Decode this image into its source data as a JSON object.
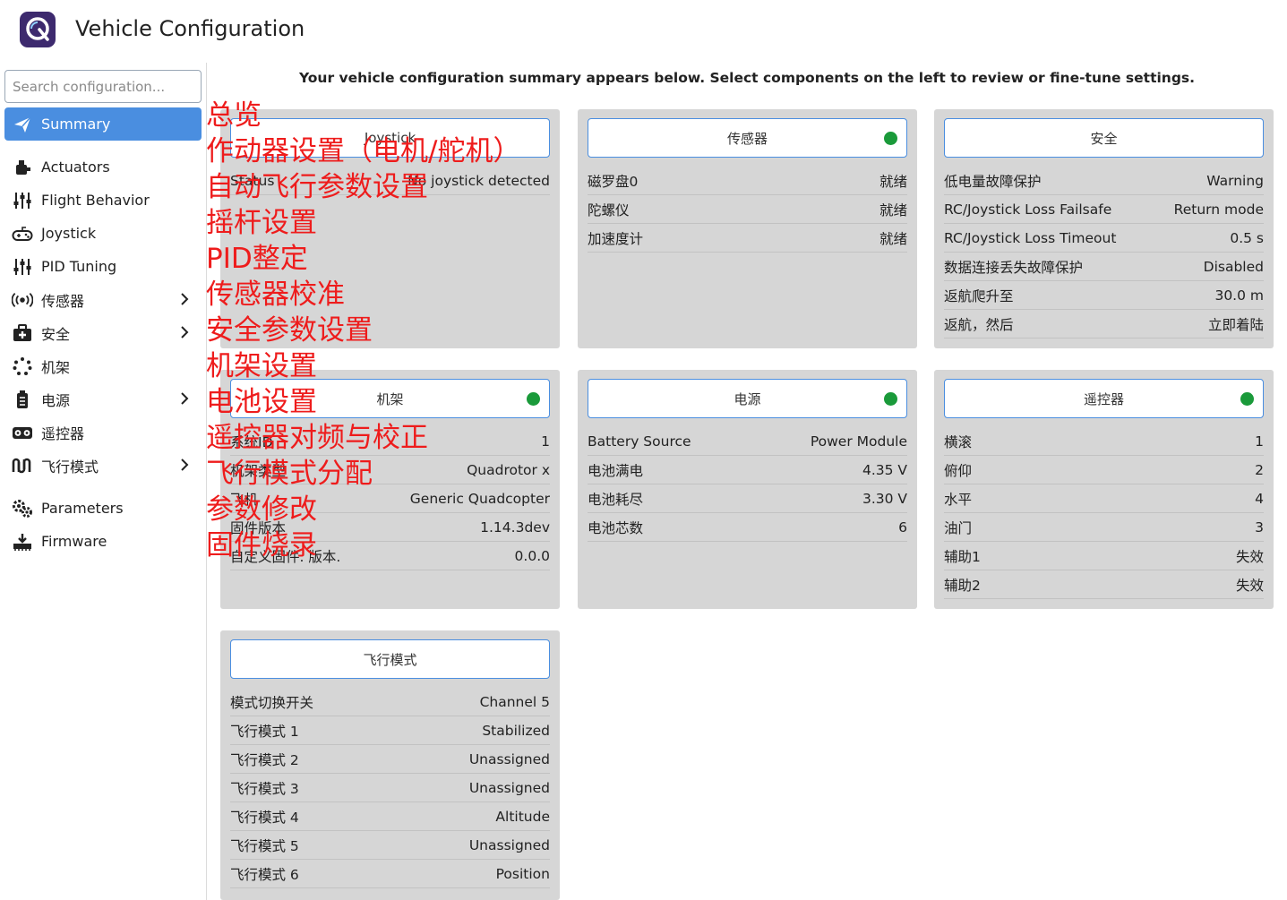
{
  "app": {
    "title": "Vehicle Configuration",
    "logo_icon": "qgc-logo-icon",
    "accent": "#4a8ee0",
    "status_ok": "#1a9a3a",
    "annotation_color": "#ee1c1c"
  },
  "search": {
    "placeholder": "Search configuration..."
  },
  "sidebar": {
    "items": [
      {
        "label": "Summary",
        "icon": "paper-plane-icon",
        "active": true
      },
      {
        "label": "Actuators",
        "icon": "motor-icon"
      },
      {
        "label": "Flight Behavior",
        "icon": "sliders-icon"
      },
      {
        "label": "Joystick",
        "icon": "gamepad-icon"
      },
      {
        "label": "PID Tuning",
        "icon": "sliders-icon"
      },
      {
        "label": "传感器",
        "icon": "radio-waves-icon",
        "has_submenu": true
      },
      {
        "label": "安全",
        "icon": "medkit-icon",
        "has_submenu": true
      },
      {
        "label": "机架",
        "icon": "airframe-icon"
      },
      {
        "label": "电源",
        "icon": "battery-icon",
        "has_submenu": true
      },
      {
        "label": "遥控器",
        "icon": "rc-icon"
      },
      {
        "label": "飞行模式",
        "icon": "flight-modes-icon",
        "has_submenu": true
      },
      {
        "label": "Parameters",
        "icon": "gears-icon"
      },
      {
        "label": "Firmware",
        "icon": "firmware-icon"
      }
    ]
  },
  "intro": "Your vehicle configuration summary appears below. Select components on the left to review or fine-tune settings.",
  "cards": {
    "joystick": {
      "title": "Joystick",
      "rows": [
        {
          "label": "Status",
          "value": "No joystick detected"
        }
      ]
    },
    "sensors": {
      "title": "传感器",
      "rows": [
        {
          "label": "磁罗盘0",
          "value": "就绪"
        },
        {
          "label": "陀螺仪",
          "value": "就绪"
        },
        {
          "label": "加速度计",
          "value": "就绪"
        }
      ]
    },
    "safety": {
      "title": "安全",
      "rows": [
        {
          "label": "低电量故障保护",
          "value": "Warning"
        },
        {
          "label": "RC/Joystick Loss Failsafe",
          "value": "Return mode"
        },
        {
          "label": "RC/Joystick Loss Timeout",
          "value": "0.5 s"
        },
        {
          "label": "数据连接丢失故障保护",
          "value": "Disabled"
        },
        {
          "label": "返航爬升至",
          "value": "30.0 m"
        },
        {
          "label": "返航，然后",
          "value": "立即着陆"
        }
      ]
    },
    "airframe": {
      "title": "机架",
      "rows": [
        {
          "label": "系统ID",
          "value": "1"
        },
        {
          "label": "机架类型",
          "value": "Quadrotor x"
        },
        {
          "label": "飞机",
          "value": "Generic Quadcopter"
        },
        {
          "label": "固件版本",
          "value": "1.14.3dev"
        },
        {
          "label": "自定义固件. 版本.",
          "value": "0.0.0"
        }
      ]
    },
    "power": {
      "title": "电源",
      "rows": [
        {
          "label": "Battery Source",
          "value": "Power Module"
        },
        {
          "label": "电池满电",
          "value": "4.35 V"
        },
        {
          "label": "电池耗尽",
          "value": "3.30 V"
        },
        {
          "label": "电池芯数",
          "value": "6"
        }
      ]
    },
    "radio": {
      "title": "遥控器",
      "rows": [
        {
          "label": "横滚",
          "value": "1"
        },
        {
          "label": "俯仰",
          "value": "2"
        },
        {
          "label": "水平",
          "value": "4"
        },
        {
          "label": "油门",
          "value": "3"
        },
        {
          "label": "辅助1",
          "value": "失效"
        },
        {
          "label": "辅助2",
          "value": "失效"
        }
      ]
    },
    "flight_modes": {
      "title": "飞行模式",
      "rows": [
        {
          "label": "模式切换开关",
          "value": "Channel 5"
        },
        {
          "label": "飞行模式 1",
          "value": "Stabilized"
        },
        {
          "label": "飞行模式 2",
          "value": "Unassigned"
        },
        {
          "label": "飞行模式 3",
          "value": "Unassigned"
        },
        {
          "label": "飞行模式 4",
          "value": "Altitude"
        },
        {
          "label": "飞行模式 5",
          "value": "Unassigned"
        },
        {
          "label": "飞行模式 6",
          "value": "Position"
        }
      ]
    }
  },
  "annotations": [
    "总览",
    "作动器设置（电机/舵机）",
    "自动飞行参数设置",
    "摇杆设置",
    "PID整定",
    "传感器校准",
    "安全参数设置",
    "机架设置",
    "电池设置",
    "遥控器对频与校正",
    "飞行模式分配",
    "参数修改",
    "固件烧录"
  ]
}
